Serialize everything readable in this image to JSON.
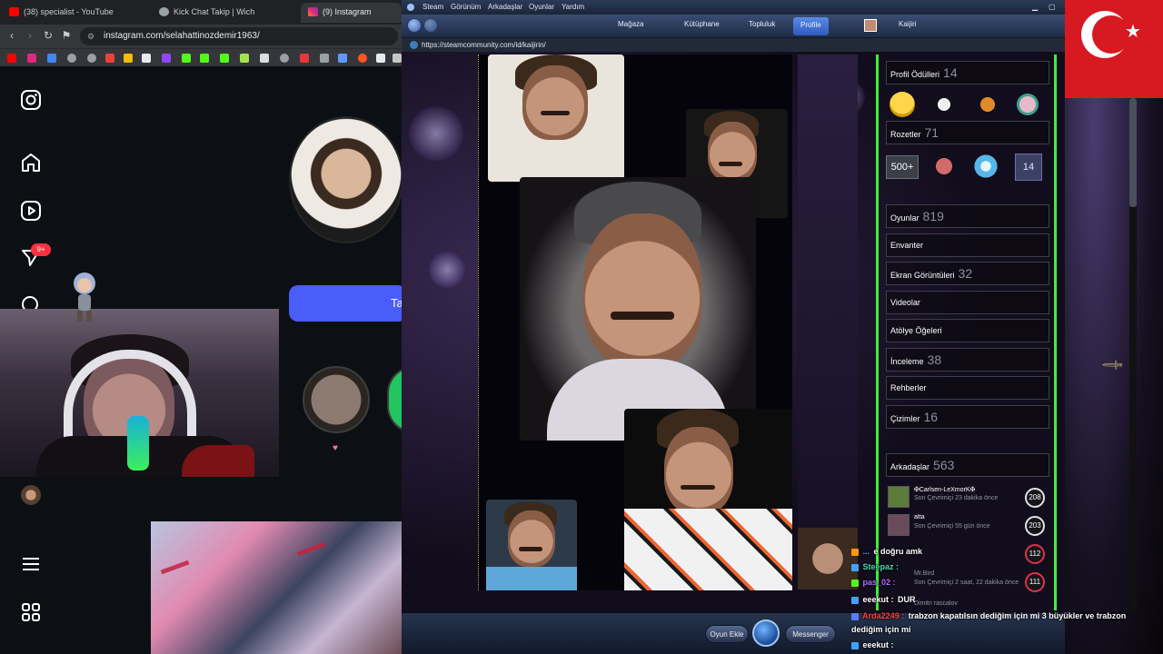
{
  "browser": {
    "tabs": [
      {
        "title": "(38) specialist - YouTube",
        "color": "#ff0000"
      },
      {
        "title": "Kick Chat Takip | Wich",
        "color": "#9aa0a6"
      },
      {
        "title": "(9) Instagram",
        "color": "#e1306c"
      }
    ],
    "url": "instagram.com/selahattinozdemir1963/"
  },
  "instagram": {
    "notification_badge": "9+",
    "follow_button_label": "Ta"
  },
  "steam": {
    "menu": [
      "Steam",
      "Görünüm",
      "Arkadaşlar",
      "Oyunlar",
      "Yardım"
    ],
    "nav": [
      "Mağaza",
      "Kütüphane",
      "Topluluk",
      "Profile"
    ],
    "nav_active": "Profile",
    "username": "Kaijiri",
    "url": "https://steamcommunity.com/id/kaijirin/",
    "sidebar": {
      "profile_awards": {
        "label": "Profil Ödülleri",
        "count": "14"
      },
      "badges": {
        "label": "Rozetler",
        "count": "71"
      },
      "badge_texts": [
        "500+",
        "14"
      ],
      "games": {
        "label": "Oyunlar",
        "count": "819"
      },
      "inventory": {
        "label": "Envanter"
      },
      "screenshots": {
        "label": "Ekran Görüntüleri",
        "count": "32"
      },
      "videos": {
        "label": "Videolar"
      },
      "workshop": {
        "label": "Atölye Öğeleri"
      },
      "reviews": {
        "label": "İnceleme",
        "count": "38"
      },
      "guides": {
        "label": "Rehberler"
      },
      "artwork": {
        "label": "Çizimler",
        "count": "16"
      },
      "friends": {
        "label": "Arkadaşlar",
        "count": "563"
      },
      "friend_list": [
        {
          "name": "✠Carlsen-LeXmorK✠",
          "status": "Son Çevrimiçi 23 dakika önce",
          "level": "208"
        },
        {
          "name": "atta",
          "status": "Son Çevrimiçi 55 gün önce",
          "level": "203"
        },
        {
          "name": "",
          "status": "",
          "level": "112"
        },
        {
          "name": "Mr.Bird",
          "status": "Son Çevrimiçi 2 saat, 22 dakika önce",
          "level": "111"
        },
        {
          "name": "Dimitri rascalov",
          "status": "",
          "level": ""
        }
      ]
    },
    "bottom": {
      "left_button": "Oyun Ekle",
      "right_button": "Messenger"
    }
  },
  "chat": [
    {
      "user": "...",
      "message": "e doğru amk",
      "color": "#5aa7ff"
    },
    {
      "user": "Steepaz :",
      "message": "",
      "color": "#4ed8a8"
    },
    {
      "user": "pas_02 :",
      "message": "",
      "color": "#b36bff"
    },
    {
      "user": "eeekut :",
      "message": "DUR",
      "color": "#ffffff"
    },
    {
      "user": "Arda2249 :",
      "message": "trabzon kapatılsın dediğim için mi 3 büyükler ve trabzon dediğim için mi",
      "color": "#ff4040"
    },
    {
      "user": "eeekut :",
      "message": "",
      "color": "#ffffff"
    }
  ],
  "colors": {
    "steam_green_border": "#3df038",
    "instagram_button": "#4a5df9",
    "flag_red": "#d71921"
  }
}
